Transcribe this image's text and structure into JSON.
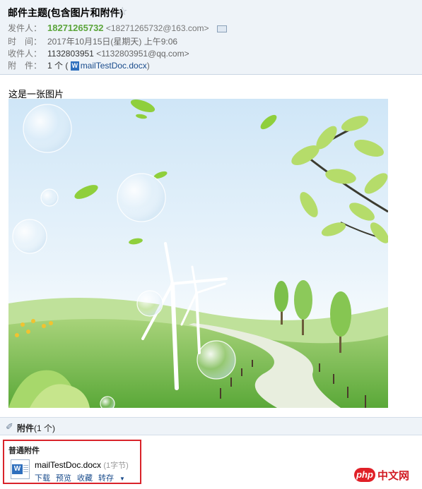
{
  "email": {
    "subject": "邮件主题(包含图片和附件)",
    "star": "☆",
    "from_label": "发件人：",
    "from_name": "18271265732",
    "from_addr": "<18271265732@163.com>",
    "time_label": "时　间：",
    "time_value": "2017年10月15日(星期天) 上午9:06",
    "to_label": "收件人：",
    "to_name": "1132803951",
    "to_addr": "<1132803951@qq.com>",
    "attach_label": "附　件：",
    "attach_count": "1 个 (",
    "attach_file": "mailTestDoc.docx",
    "attach_close": ")"
  },
  "body": {
    "text": "这是一张图片"
  },
  "attachments": {
    "bar_title": "附件",
    "bar_count": "(1 个)",
    "section_title": "普通附件",
    "file_name": "mailTestDoc.docx",
    "file_size": "(1字节)",
    "actions": [
      "下载",
      "预览",
      "收藏",
      "转存"
    ]
  },
  "icons": {
    "word": "W",
    "clip": "📎",
    "caret": "▼"
  },
  "watermark": {
    "php": "php",
    "site": "中文网"
  }
}
